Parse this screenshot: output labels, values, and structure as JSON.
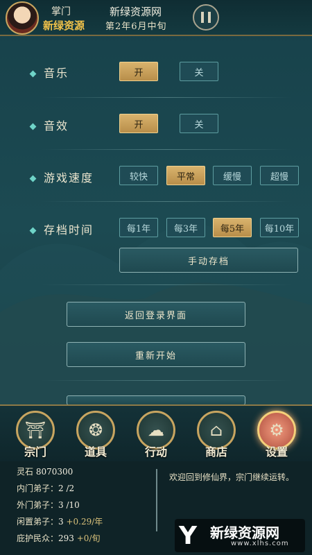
{
  "header": {
    "role": "掌门",
    "sect_name": "新绿资源",
    "brand": "新绿资源网",
    "date": "第2年6月中旬"
  },
  "settings": {
    "music": {
      "label": "音乐",
      "options": [
        "开",
        "关"
      ],
      "selected": "开"
    },
    "sound": {
      "label": "音效",
      "options": [
        "开",
        "关"
      ],
      "selected": "开"
    },
    "speed": {
      "label": "游戏速度",
      "options": [
        "较快",
        "平常",
        "缓慢",
        "超慢"
      ],
      "selected": "平常"
    },
    "save": {
      "label": "存档时间",
      "options": [
        "每1年",
        "每3年",
        "每5年",
        "每10年"
      ],
      "selected": "每5年"
    },
    "manual_save": "手动存档",
    "return_login": "返回登录界面",
    "restart": "重新开始"
  },
  "nav": {
    "items": [
      "宗门",
      "道具",
      "行动",
      "商店",
      "设置"
    ],
    "active": "设置"
  },
  "stats": {
    "spirit_stone_label": "灵石",
    "spirit_stone": "8070300",
    "inner_label": "内门弟子：",
    "inner": "2 /2",
    "outer_label": "外门弟子：",
    "outer": "3 /10",
    "idle_label": "闲置弟子：",
    "idle": "3",
    "idle_rate": "+0.29/年",
    "people_label": "庇护民众：",
    "people": "293",
    "people_rate": "+0/旬"
  },
  "message": "欢迎回到修仙界，宗门继续运转。",
  "watermark": {
    "title": "新绿资源网",
    "url": "www.xlhs.com"
  },
  "colors": {
    "accent_gold": "#d9b36d",
    "teal": "#6fd4c8",
    "bg": "#1c4a52"
  }
}
